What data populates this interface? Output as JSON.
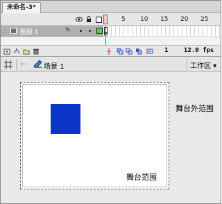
{
  "document": {
    "tab_title": "未命名-3*"
  },
  "timeline": {
    "frame_numbers": [
      "5",
      "10",
      "15",
      "20",
      "25"
    ],
    "layer": {
      "name": "图层 1"
    },
    "current_frame": "1",
    "fps": "12.0 fps"
  },
  "editbar": {
    "scene": "场景 1",
    "workspace": "工作区 ▾"
  },
  "stage": {
    "stage_label": "舞台范围",
    "outside_label": "舞台外范围",
    "shape_color": "#0a35c8"
  }
}
